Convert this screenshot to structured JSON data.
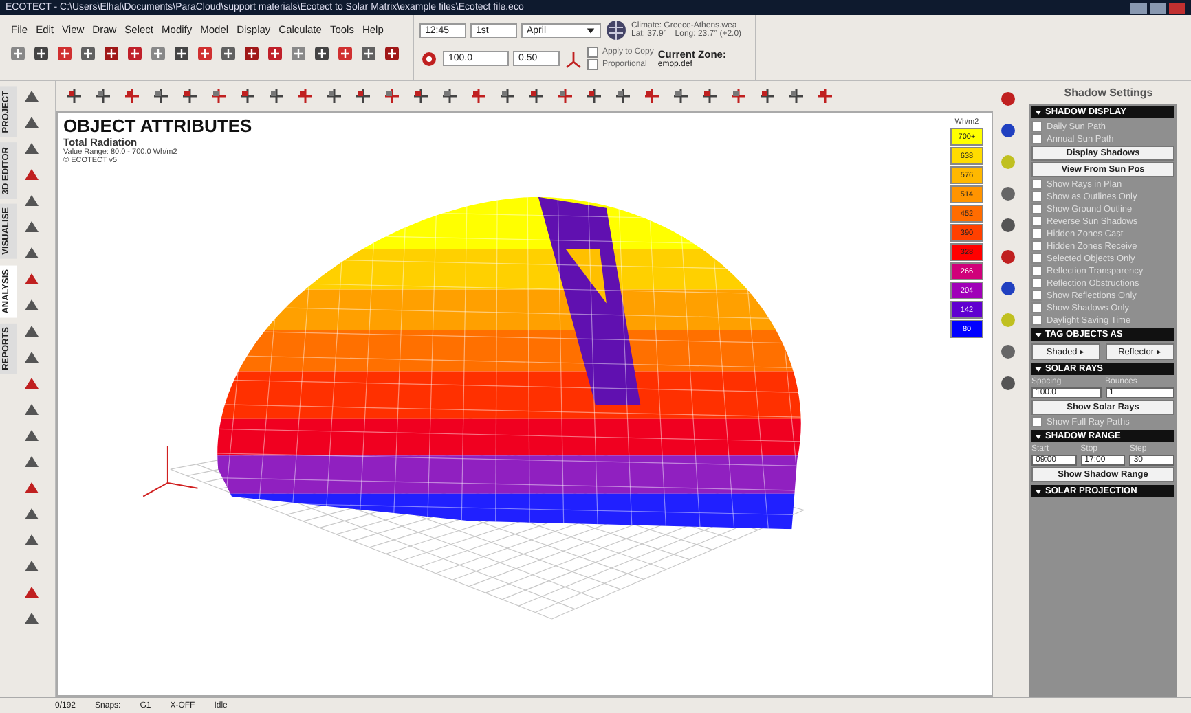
{
  "window": {
    "title": "ECOTECT - C:\\Users\\Elhal\\Documents\\ParaCloud\\support materials\\Ecotect to Solar Matrix\\example files\\Ecotect file.eco"
  },
  "menu": [
    "File",
    "Edit",
    "View",
    "Draw",
    "Select",
    "Modify",
    "Model",
    "Display",
    "Calculate",
    "Tools",
    "Help"
  ],
  "time_controls": {
    "time": "12:45",
    "day": "1st",
    "month": "April",
    "climate": "Climate: Greece-Athens.wea",
    "lat": "Lat: 37.9°",
    "long": "Long: 23.7° (+2.0)"
  },
  "scale_controls": {
    "scale": "100.0",
    "factor": "0.50",
    "apply_to_copy": {
      "label": "Apply to Copy",
      "checked": false
    },
    "proportional": {
      "label": "Proportional",
      "checked": false
    },
    "zone_label": "Current Zone:",
    "zone": "emop.def"
  },
  "side_tabs": [
    {
      "label": "PROJECT",
      "selected": false
    },
    {
      "label": "3D EDITOR",
      "selected": false
    },
    {
      "label": "VISUALISE",
      "selected": false
    },
    {
      "label": "ANALYSIS",
      "selected": true
    },
    {
      "label": "REPORTS",
      "selected": false
    }
  ],
  "viewport": {
    "title": "OBJECT ATTRIBUTES",
    "subtitle": "Total Radiation",
    "range": "Value Range: 80.0 - 700.0 Wh/m2",
    "note": "© ECOTECT v5",
    "legend_unit": "Wh/m2",
    "legend": [
      {
        "value": "700+",
        "color": "#ffff00"
      },
      {
        "value": "638",
        "color": "#ffdc00"
      },
      {
        "value": "576",
        "color": "#ffb800"
      },
      {
        "value": "514",
        "color": "#ff9400"
      },
      {
        "value": "452",
        "color": "#ff6c00"
      },
      {
        "value": "390",
        "color": "#ff4000"
      },
      {
        "value": "328",
        "color": "#ff0000"
      },
      {
        "value": "266",
        "color": "#d0007a"
      },
      {
        "value": "204",
        "color": "#a000b8"
      },
      {
        "value": "142",
        "color": "#6000d0"
      },
      {
        "value": "80",
        "color": "#0000ff"
      }
    ]
  },
  "panel": {
    "title": "Shadow Settings",
    "sections": [
      {
        "title": "SHADOW DISPLAY",
        "items": [
          {
            "kind": "checkbox",
            "label": "Daily Sun Path",
            "checked": false
          },
          {
            "kind": "checkbox",
            "label": "Annual Sun Path",
            "checked": false
          },
          {
            "kind": "button",
            "label": "Display Shadows"
          },
          {
            "kind": "button",
            "label": "View From Sun Pos"
          },
          {
            "kind": "checkbox",
            "label": "Show Rays in Plan",
            "checked": false
          },
          {
            "kind": "checkbox",
            "label": "Show as Outlines Only",
            "checked": false
          },
          {
            "kind": "checkbox",
            "label": "Show Ground Outline",
            "checked": false
          },
          {
            "kind": "checkbox",
            "label": "Reverse Sun Shadows",
            "checked": false
          },
          {
            "kind": "checkbox",
            "label": "Hidden Zones Cast",
            "checked": false
          },
          {
            "kind": "checkbox",
            "label": "Hidden Zones Receive",
            "checked": false
          },
          {
            "kind": "checkbox",
            "label": "Selected Objects Only",
            "checked": false
          },
          {
            "kind": "checkbox",
            "label": "Reflection Transparency",
            "checked": false
          },
          {
            "kind": "checkbox",
            "label": "Reflection Obstructions",
            "checked": false
          },
          {
            "kind": "checkbox",
            "label": "Show Reflections Only",
            "checked": false
          },
          {
            "kind": "checkbox",
            "label": "Show Shadows Only",
            "checked": false
          },
          {
            "kind": "checkbox",
            "label": "Daylight Saving Time",
            "checked": false
          }
        ]
      },
      {
        "title": "TAG OBJECTS AS",
        "items": [
          {
            "kind": "menus",
            "labels": [
              "Shaded ▸",
              "Reflector ▸"
            ]
          }
        ]
      },
      {
        "title": "SOLAR RAYS",
        "items": [
          {
            "kind": "fields",
            "labels": [
              "Spacing",
              "Bounces"
            ],
            "values": [
              "100.0",
              "1"
            ]
          },
          {
            "kind": "button",
            "label": "Show Solar Rays"
          },
          {
            "kind": "checkbox",
            "label": "Show Full Ray Paths",
            "checked": false
          }
        ]
      },
      {
        "title": "SHADOW RANGE",
        "items": [
          {
            "kind": "fields",
            "labels": [
              "Start",
              "Stop",
              "Step"
            ],
            "values": [
              "09:00",
              "17:00",
              "30"
            ]
          },
          {
            "kind": "button",
            "label": "Show Shadow Range"
          }
        ]
      },
      {
        "title": "SOLAR PROJECTION"
      }
    ]
  },
  "status_bar": [
    "0/192",
    "Snaps:",
    "G1",
    "X-OFF",
    "Idle"
  ]
}
